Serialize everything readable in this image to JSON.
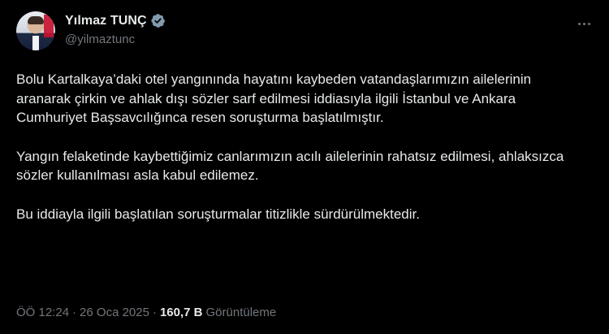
{
  "author": {
    "display_name": "Yılmaz TUNÇ",
    "handle": "@yilmaztunc",
    "verified": true
  },
  "tweet": {
    "paragraphs": [
      "Bolu Kartalkaya’daki otel yangınında hayatını kaybeden vatandaşlarımızın ailelerinin aranarak çirkin ve ahlak dışı sözler sarf edilmesi iddiasıyla ilgili İstanbul ve Ankara Cumhuriyet Başsavcılığınca resen soruşturma başlatılmıştır.",
      "Yangın felaketinde kaybettiğimiz canlarımızın acılı ailelerinin rahatsız edilmesi, ahlaksızca sözler kullanılması asla kabul edilemez.",
      "Bu iddiayla ilgili başlatılan soruşturmalar titizlikle sürdürülmektedir."
    ]
  },
  "meta": {
    "time": "ÖÖ 12:24",
    "separator": "·",
    "date": "26 Oca 2025",
    "views_count": "160,7 B",
    "views_label": "Görüntüleme"
  },
  "icons": {
    "verified": "verified-badge-icon",
    "more": "more-horizontal-icon"
  },
  "colors": {
    "background": "#000000",
    "text_primary": "#e7e9ea",
    "text_secondary": "#71767b",
    "verified_badge": "#829aab"
  }
}
